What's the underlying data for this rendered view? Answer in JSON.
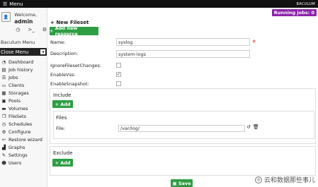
{
  "topbar": {
    "menu_label": "Menu",
    "brand": "BACULUM"
  },
  "sidebar": {
    "welcome": "Welcome,",
    "username": "admin",
    "title": "Baculum Menu",
    "close_menu": "Close Menu",
    "items": [
      {
        "label": "Dashboard",
        "icon": "tachometer-icon"
      },
      {
        "label": "Job history",
        "icon": "history-icon"
      },
      {
        "label": "Jobs",
        "icon": "tasks-icon"
      },
      {
        "label": "Clients",
        "icon": "desktop-icon"
      },
      {
        "label": "Storages",
        "icon": "database-icon"
      },
      {
        "label": "Pools",
        "icon": "tape-icon"
      },
      {
        "label": "Volumes",
        "icon": "hdd-icon"
      },
      {
        "label": "FileSets",
        "icon": "copy-icon"
      },
      {
        "label": "Schedules",
        "icon": "clock-icon"
      },
      {
        "label": "Configure",
        "icon": "cog-icon"
      },
      {
        "label": "Restore wizard",
        "icon": "reply-icon"
      },
      {
        "label": "Graphs",
        "icon": "chart-icon"
      },
      {
        "label": "Settings",
        "icon": "wrench-icon"
      },
      {
        "label": "Users",
        "icon": "users-icon"
      }
    ]
  },
  "header": {
    "running_jobs": "Running jobs: 0"
  },
  "form": {
    "heading": "New Fileset",
    "add_resource": "Add new resource",
    "name_label": "Name:",
    "name_value": "syslog",
    "description_label": "Description:",
    "description_value": "system-logs",
    "ignore_label": "IgnoreFilesetChanges:",
    "ignore_checked": false,
    "vss_label": "EnableVss:",
    "vss_checked": true,
    "snapshot_label": "EnableSnapshot:",
    "snapshot_checked": false
  },
  "include": {
    "title": "Include",
    "add_label": "Add",
    "files_title": "Files",
    "file_label": "File:",
    "file_value": "/var/log/"
  },
  "exclude": {
    "title": "Exclude",
    "add_label": "Add"
  },
  "save_label": "Save",
  "watermark": "云和数据那些事儿"
}
